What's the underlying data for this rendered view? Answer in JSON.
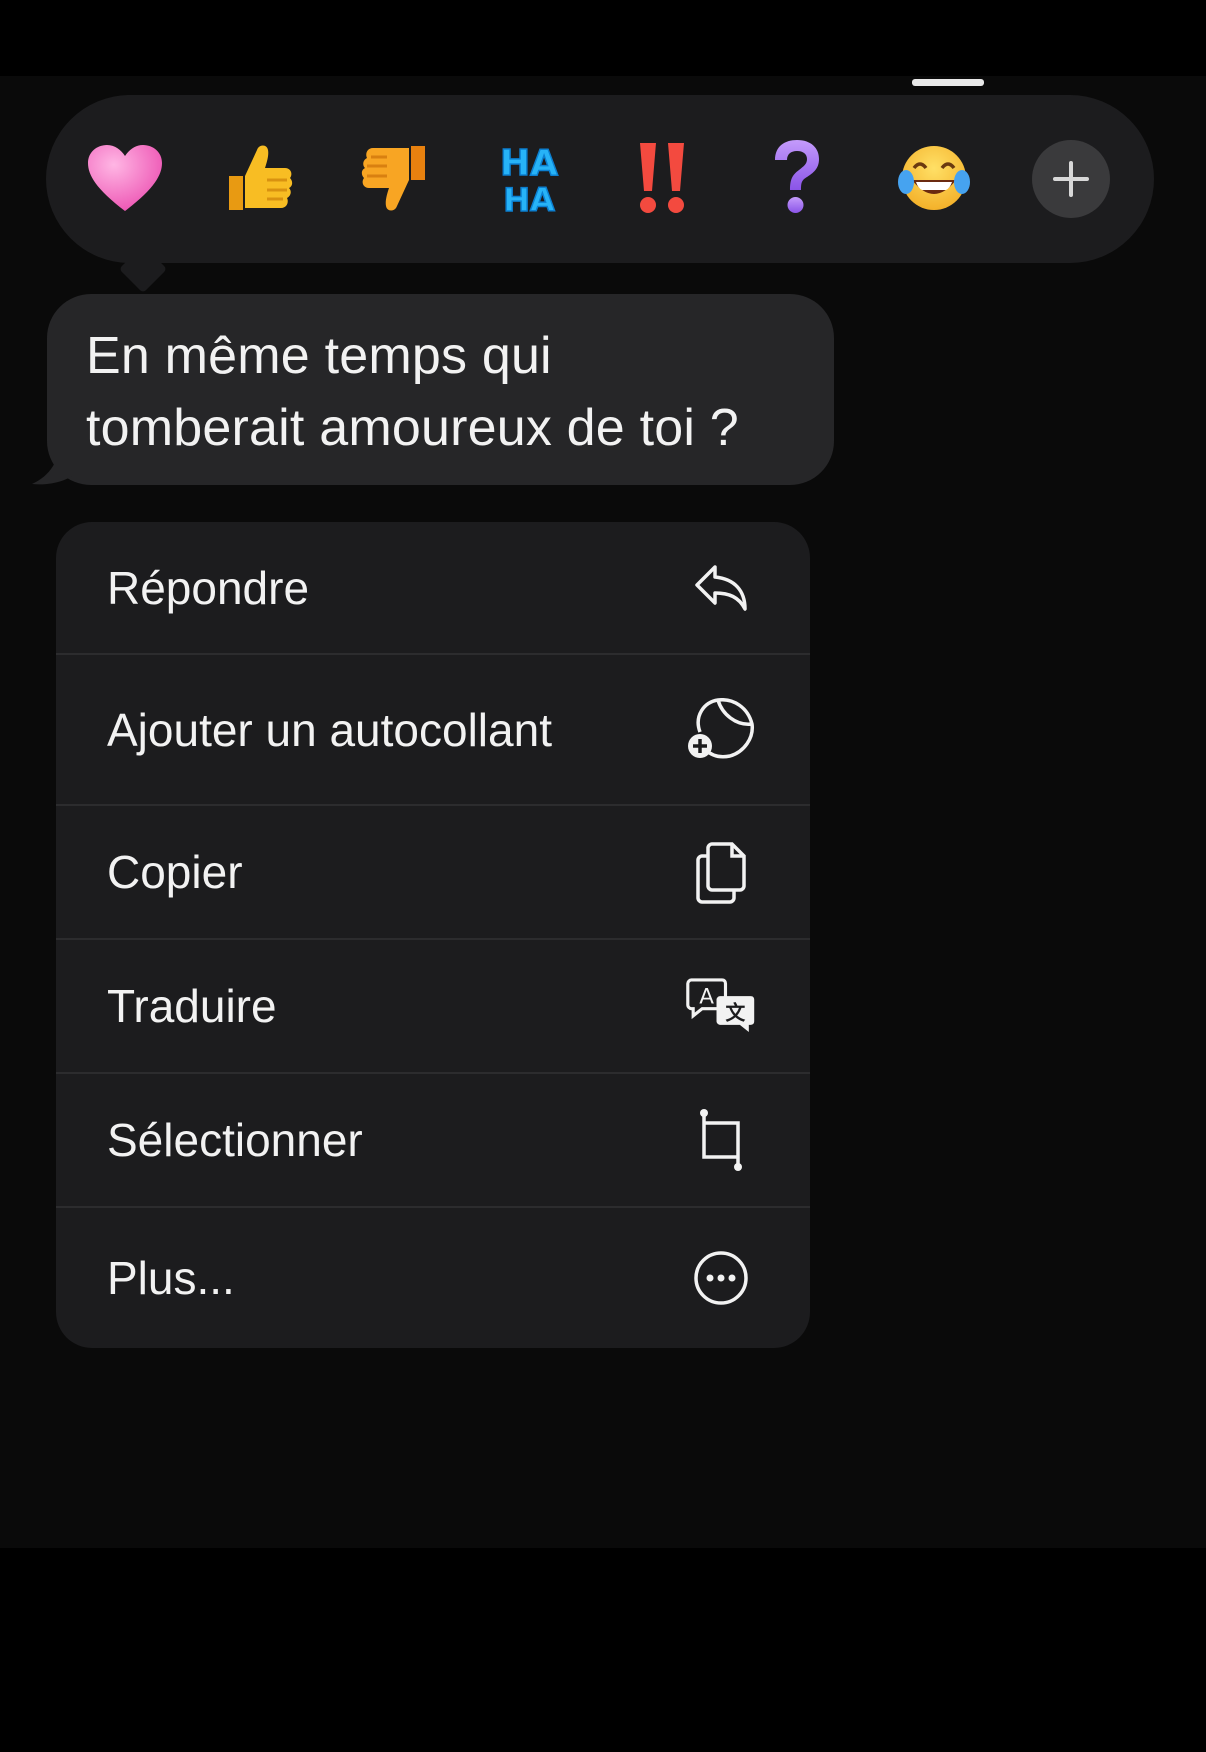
{
  "reactions": [
    {
      "name": "heart",
      "glyph": "heart",
      "color": "#f778c6"
    },
    {
      "name": "thumbs-up",
      "glyph": "thumbs-up",
      "color": "#f6b41b"
    },
    {
      "name": "thumbs-down",
      "glyph": "thumbs-down",
      "color": "#f6a11b"
    },
    {
      "name": "haha",
      "text_top": "HA",
      "text_bottom": "HA",
      "color": "#1aa5f5"
    },
    {
      "name": "exclamation",
      "text": "!!",
      "color": "#f0413c"
    },
    {
      "name": "question",
      "text": "?",
      "color": "#a16df1"
    },
    {
      "name": "laughing-face",
      "glyph": "face-with-tears-of-joy",
      "color": "#f7c53a"
    }
  ],
  "more_reactions_icon": "plus-icon",
  "message": {
    "line1": "En même temps qui",
    "line2": "tomberait amoureux de toi ?"
  },
  "menu": {
    "items": [
      {
        "label": "Répondre",
        "icon": "reply-arrow-icon"
      },
      {
        "label": "Ajouter un autocollant",
        "icon": "sticker-add-icon"
      },
      {
        "label": "Copier",
        "icon": "copy-icon"
      },
      {
        "label": "Traduire",
        "icon": "translate-icon"
      },
      {
        "label": "Sélectionner",
        "icon": "crop-select-icon"
      },
      {
        "label": "Plus...",
        "icon": "more-ellipsis-icon"
      }
    ]
  },
  "colors": {
    "background": "#0a0a0a",
    "bubble": "#262628",
    "menu": "#1c1c1e"
  }
}
